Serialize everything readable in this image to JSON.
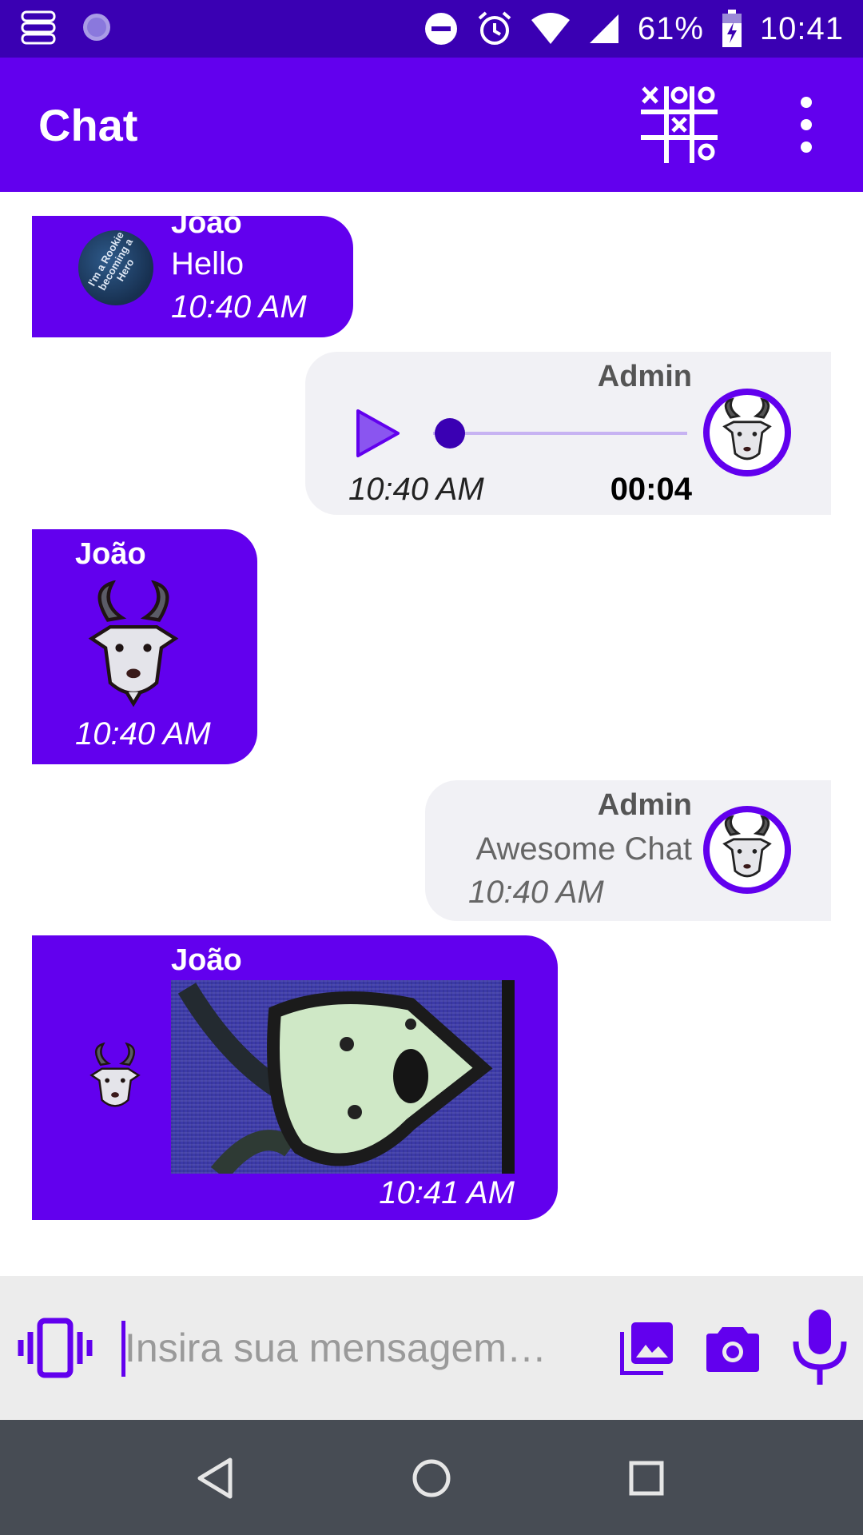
{
  "status_bar": {
    "battery": "61%",
    "time": "10:41",
    "icons": [
      "storage-icon",
      "loading-icon",
      "dnd-icon",
      "alarm-icon",
      "wifi-icon",
      "signal-icon",
      "battery-charging-icon"
    ]
  },
  "app_bar": {
    "title": "Chat",
    "actions": [
      "tic-tac-toe-icon",
      "more-vert-icon"
    ]
  },
  "messages": [
    {
      "type": "text",
      "direction": "in",
      "sender": "João",
      "text": "Hello",
      "time": "10:40 AM"
    },
    {
      "type": "audio",
      "direction": "out",
      "sender": "Admin",
      "duration": "00:04",
      "progress": 0,
      "time": "10:40 AM"
    },
    {
      "type": "sticker",
      "direction": "in",
      "sender": "João",
      "sticker": "goat-icon",
      "time": "10:40 AM"
    },
    {
      "type": "text",
      "direction": "out",
      "sender": "Admin",
      "text": "Awesome Chat",
      "time": "10:40 AM"
    },
    {
      "type": "image",
      "direction": "in",
      "sender": "João",
      "time": "10:41 AM"
    }
  ],
  "input": {
    "placeholder": "Insira sua mensagem…",
    "value": ""
  },
  "colors": {
    "primary": "#6200ee",
    "primary_dark": "#3a00b3",
    "incoming_bubble": "#6200ee",
    "outgoing_bubble": "#f1f1f5",
    "nav_bar": "#474c54"
  }
}
